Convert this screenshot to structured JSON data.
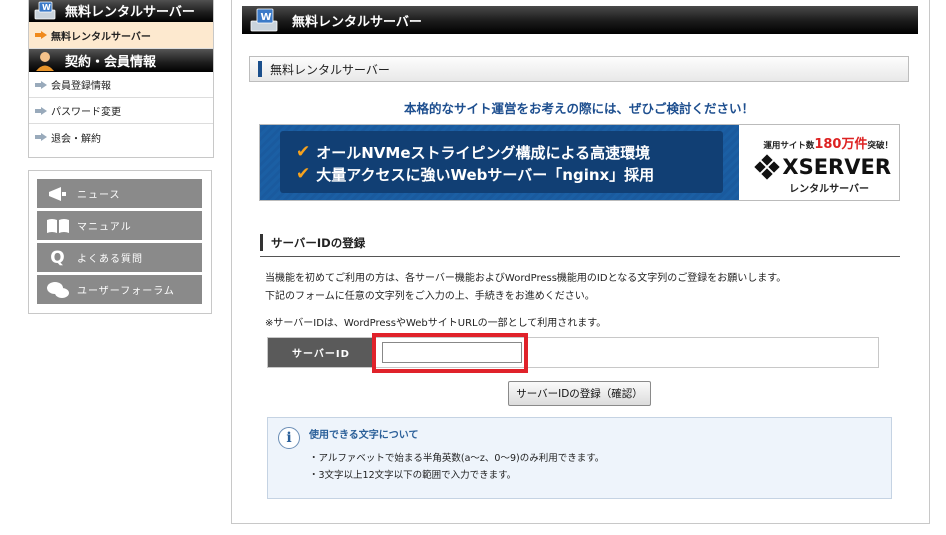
{
  "sidebar": {
    "section1_title": "無料レンタルサーバー",
    "section1_items": [
      {
        "label": "無料レンタルサーバー",
        "active": true
      }
    ],
    "section2_title": "契約・会員情報",
    "section2_items": [
      {
        "label": "会員登録情報"
      },
      {
        "label": "パスワード変更"
      },
      {
        "label": "退会・解約"
      }
    ],
    "links": [
      {
        "label": "ニュース",
        "icon": "megaphone-icon"
      },
      {
        "label": "マニュアル",
        "icon": "book-icon"
      },
      {
        "label": "よくある質問",
        "icon": "question-icon"
      },
      {
        "label": "ユーザーフォーラム",
        "icon": "chat-icon"
      }
    ]
  },
  "main": {
    "header_title": "無料レンタルサーバー",
    "sub_header": "無料レンタルサーバー",
    "tagline": "本格的なサイト運営をお考えの際には、ぜひご検討ください！",
    "banner": {
      "line1": "オールNVMeストライピング構成による高速環境",
      "line2": "大量アクセスに強いWebサーバー「nginx」採用",
      "badge_prefix": "運用サイト数",
      "badge_number": "180万件",
      "badge_suffix": "突破！",
      "logo": "XSERVER",
      "logo_sub": "レンタルサーバー"
    },
    "section_title": "サーバーIDの登録",
    "desc1": "当機能を初めてご利用の方は、各サーバー機能およびWordPress機能用のIDとなる文字列のご登録をお願いします。",
    "desc2": "下記のフォームに任意の文字列をご入力の上、手続きをお進めください。",
    "note": "※サーバーIDは、WordPressやWebサイトURLの一部として利用されます。",
    "form": {
      "label": "サーバーID",
      "value": "",
      "submit_label": "サーバーIDの登録（確認）"
    },
    "info": {
      "title": "使用できる文字について",
      "lines": [
        "・アルファベットで始まる半角英数(a～z、0～9)のみ利用できます。",
        "・3文字以上12文字以下の範囲で入力できます。"
      ]
    }
  },
  "colors": {
    "accent_blue": "#1e4f8f",
    "highlight_red": "#e0222a",
    "active_bg": "#fde9cf",
    "arrow_orange": "#f08a1c"
  }
}
